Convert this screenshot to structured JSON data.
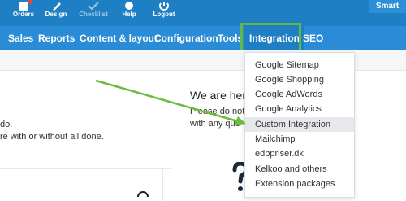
{
  "toolbar": {
    "items": [
      {
        "label": "Orders",
        "icon": "orders-icon"
      },
      {
        "label": "Design",
        "icon": "design-icon"
      },
      {
        "label": "Checklist",
        "icon": "checklist-icon"
      },
      {
        "label": "Help",
        "icon": "help-icon"
      },
      {
        "label": "Logout",
        "icon": "logout-icon"
      }
    ],
    "brand_label": "Smart"
  },
  "nav": {
    "items": [
      "Sales",
      "Reports",
      "Content & layout",
      "Configuration",
      "Tools",
      "Integration",
      "SEO"
    ],
    "active": "Integration"
  },
  "content": {
    "heading": "We are her",
    "body_line_1": "Please do not",
    "body_line_2": "with any que",
    "left_line_1": "do.",
    "left_line_2": "re with or without all done."
  },
  "dropdown": {
    "items": [
      "Google Sitemap",
      "Google Shopping",
      "Google AdWords",
      "Google Analytics",
      "Custom Integration",
      "Mailchimp",
      "edbpriser.dk",
      "Kelkoo and others",
      "Extension packages"
    ],
    "highlighted": "Custom Integration"
  },
  "colors": {
    "topbar": "#1f7fc4",
    "navbar": "#2a8bd6",
    "highlight_box": "#62b843",
    "arrow": "#6cbb3c"
  }
}
